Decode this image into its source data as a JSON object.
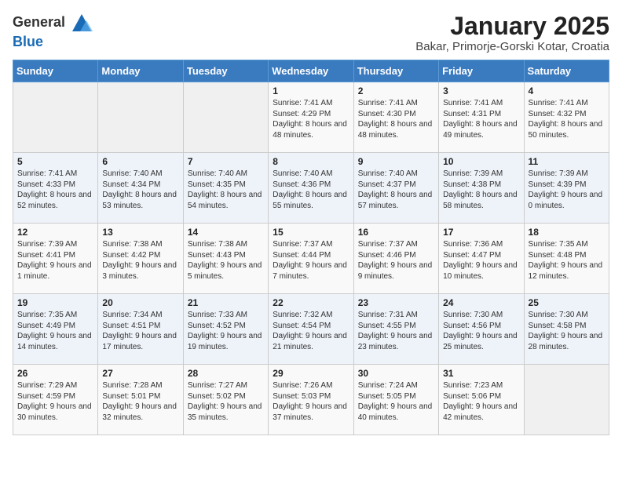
{
  "app": {
    "name_general": "General",
    "name_blue": "Blue"
  },
  "calendar": {
    "title": "January 2025",
    "subtitle": "Bakar, Primorje-Gorski Kotar, Croatia"
  },
  "headers": [
    "Sunday",
    "Monday",
    "Tuesday",
    "Wednesday",
    "Thursday",
    "Friday",
    "Saturday"
  ],
  "weeks": [
    [
      {
        "day": "",
        "content": ""
      },
      {
        "day": "",
        "content": ""
      },
      {
        "day": "",
        "content": ""
      },
      {
        "day": "1",
        "content": "Sunrise: 7:41 AM\nSunset: 4:29 PM\nDaylight: 8 hours\nand 48 minutes."
      },
      {
        "day": "2",
        "content": "Sunrise: 7:41 AM\nSunset: 4:30 PM\nDaylight: 8 hours\nand 48 minutes."
      },
      {
        "day": "3",
        "content": "Sunrise: 7:41 AM\nSunset: 4:31 PM\nDaylight: 8 hours\nand 49 minutes."
      },
      {
        "day": "4",
        "content": "Sunrise: 7:41 AM\nSunset: 4:32 PM\nDaylight: 8 hours\nand 50 minutes."
      }
    ],
    [
      {
        "day": "5",
        "content": "Sunrise: 7:41 AM\nSunset: 4:33 PM\nDaylight: 8 hours\nand 52 minutes."
      },
      {
        "day": "6",
        "content": "Sunrise: 7:40 AM\nSunset: 4:34 PM\nDaylight: 8 hours\nand 53 minutes."
      },
      {
        "day": "7",
        "content": "Sunrise: 7:40 AM\nSunset: 4:35 PM\nDaylight: 8 hours\nand 54 minutes."
      },
      {
        "day": "8",
        "content": "Sunrise: 7:40 AM\nSunset: 4:36 PM\nDaylight: 8 hours\nand 55 minutes."
      },
      {
        "day": "9",
        "content": "Sunrise: 7:40 AM\nSunset: 4:37 PM\nDaylight: 8 hours\nand 57 minutes."
      },
      {
        "day": "10",
        "content": "Sunrise: 7:39 AM\nSunset: 4:38 PM\nDaylight: 8 hours\nand 58 minutes."
      },
      {
        "day": "11",
        "content": "Sunrise: 7:39 AM\nSunset: 4:39 PM\nDaylight: 9 hours\nand 0 minutes."
      }
    ],
    [
      {
        "day": "12",
        "content": "Sunrise: 7:39 AM\nSunset: 4:41 PM\nDaylight: 9 hours\nand 1 minute."
      },
      {
        "day": "13",
        "content": "Sunrise: 7:38 AM\nSunset: 4:42 PM\nDaylight: 9 hours\nand 3 minutes."
      },
      {
        "day": "14",
        "content": "Sunrise: 7:38 AM\nSunset: 4:43 PM\nDaylight: 9 hours\nand 5 minutes."
      },
      {
        "day": "15",
        "content": "Sunrise: 7:37 AM\nSunset: 4:44 PM\nDaylight: 9 hours\nand 7 minutes."
      },
      {
        "day": "16",
        "content": "Sunrise: 7:37 AM\nSunset: 4:46 PM\nDaylight: 9 hours\nand 9 minutes."
      },
      {
        "day": "17",
        "content": "Sunrise: 7:36 AM\nSunset: 4:47 PM\nDaylight: 9 hours\nand 10 minutes."
      },
      {
        "day": "18",
        "content": "Sunrise: 7:35 AM\nSunset: 4:48 PM\nDaylight: 9 hours\nand 12 minutes."
      }
    ],
    [
      {
        "day": "19",
        "content": "Sunrise: 7:35 AM\nSunset: 4:49 PM\nDaylight: 9 hours\nand 14 minutes."
      },
      {
        "day": "20",
        "content": "Sunrise: 7:34 AM\nSunset: 4:51 PM\nDaylight: 9 hours\nand 17 minutes."
      },
      {
        "day": "21",
        "content": "Sunrise: 7:33 AM\nSunset: 4:52 PM\nDaylight: 9 hours\nand 19 minutes."
      },
      {
        "day": "22",
        "content": "Sunrise: 7:32 AM\nSunset: 4:54 PM\nDaylight: 9 hours\nand 21 minutes."
      },
      {
        "day": "23",
        "content": "Sunrise: 7:31 AM\nSunset: 4:55 PM\nDaylight: 9 hours\nand 23 minutes."
      },
      {
        "day": "24",
        "content": "Sunrise: 7:30 AM\nSunset: 4:56 PM\nDaylight: 9 hours\nand 25 minutes."
      },
      {
        "day": "25",
        "content": "Sunrise: 7:30 AM\nSunset: 4:58 PM\nDaylight: 9 hours\nand 28 minutes."
      }
    ],
    [
      {
        "day": "26",
        "content": "Sunrise: 7:29 AM\nSunset: 4:59 PM\nDaylight: 9 hours\nand 30 minutes."
      },
      {
        "day": "27",
        "content": "Sunrise: 7:28 AM\nSunset: 5:01 PM\nDaylight: 9 hours\nand 32 minutes."
      },
      {
        "day": "28",
        "content": "Sunrise: 7:27 AM\nSunset: 5:02 PM\nDaylight: 9 hours\nand 35 minutes."
      },
      {
        "day": "29",
        "content": "Sunrise: 7:26 AM\nSunset: 5:03 PM\nDaylight: 9 hours\nand 37 minutes."
      },
      {
        "day": "30",
        "content": "Sunrise: 7:24 AM\nSunset: 5:05 PM\nDaylight: 9 hours\nand 40 minutes."
      },
      {
        "day": "31",
        "content": "Sunrise: 7:23 AM\nSunset: 5:06 PM\nDaylight: 9 hours\nand 42 minutes."
      },
      {
        "day": "",
        "content": ""
      }
    ]
  ]
}
